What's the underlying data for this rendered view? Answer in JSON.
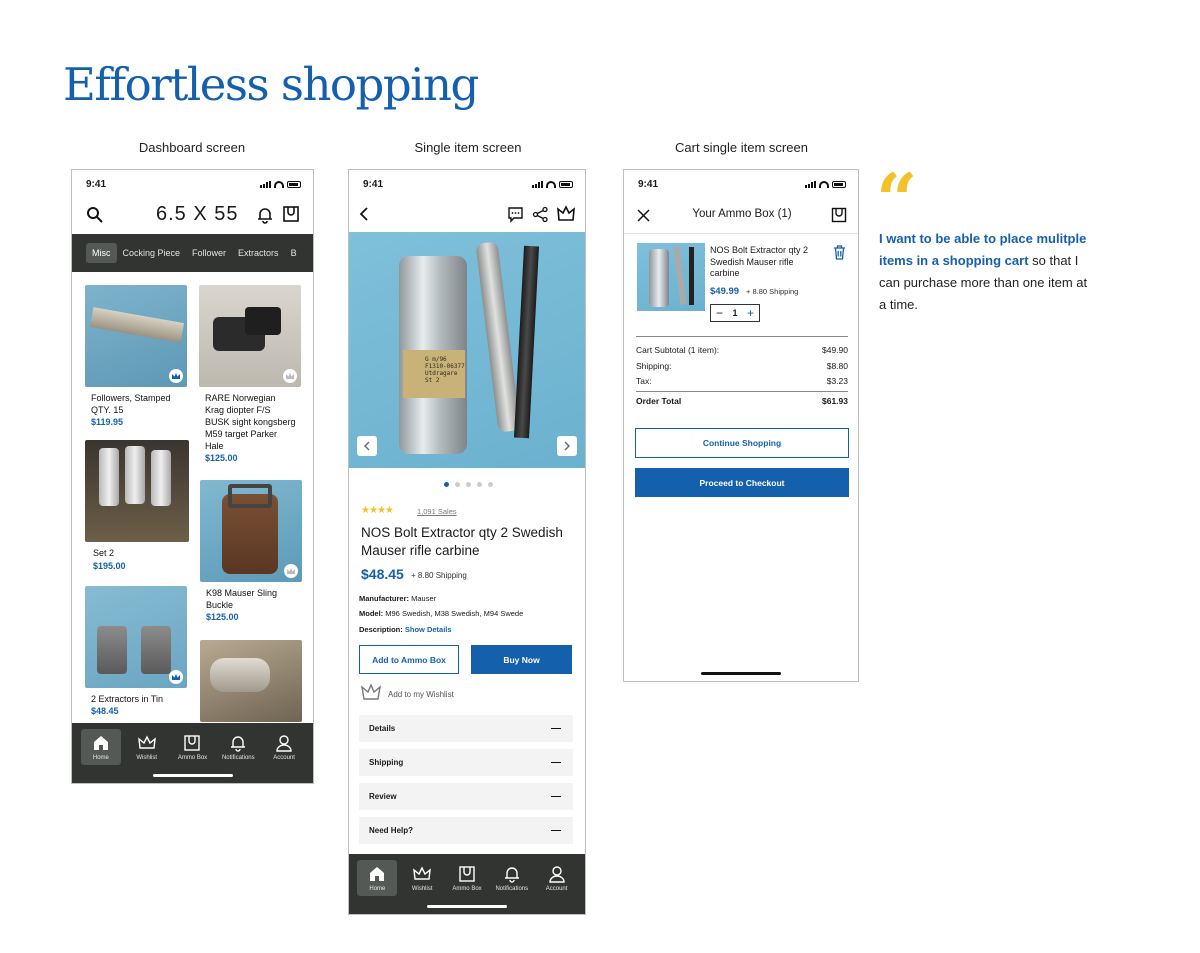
{
  "heading": "Effortless shopping",
  "captions": {
    "dashboard": "Dashboard screen",
    "single": "Single item screen",
    "cart": "Cart single item screen"
  },
  "status_time": "9:41",
  "colors": {
    "brand_blue": "#1560ad",
    "nav_dark": "#313431",
    "quote_gold": "#f3c12a"
  },
  "nav": [
    {
      "label": "Home",
      "icon": "home-icon"
    },
    {
      "label": "Wishlist",
      "icon": "crown-icon"
    },
    {
      "label": "Ammo Box",
      "icon": "box-icon"
    },
    {
      "label": "Notifications",
      "icon": "bell-icon"
    },
    {
      "label": "Account",
      "icon": "user-icon"
    }
  ],
  "dashboard": {
    "logo": "6.5 X 55",
    "categories": [
      "Misc",
      "Cocking Piece",
      "Follower",
      "Extractors",
      "B"
    ],
    "products": [
      {
        "name": "Followers, Stamped QTY. 15",
        "price": "$119.95"
      },
      {
        "name": "RARE Norwegian Krag diopter F/S BUSK sight kongsberg M59 target Parker Hale",
        "price": "$125.00"
      },
      {
        "name": "Set 2",
        "price": "$195.00"
      },
      {
        "name": "K98 Mauser Sling Buckle",
        "price": "$125.00"
      },
      {
        "name": "2 Extractors in Tin",
        "price": "$48.45"
      }
    ]
  },
  "single": {
    "sales": "1,091 Sales",
    "rating_stars": 4,
    "title": "NOS Bolt Extractor qty 2 Swedish Mauser rifle carbine",
    "price": "$48.45",
    "shipping": "+ 8.80 Shipping",
    "label_text": "G m/96\nF1310-06377\nUtdragare\nSt 2",
    "manufacturer_label": "Manufacturer:",
    "manufacturer": "Mauser",
    "model_label": "Model:",
    "model": "M96 Swedish, M38 Swedish, M94 Swede",
    "description_label": "Description:",
    "description_link": "Show Details",
    "add_button": "Add to Ammo Box",
    "buy_button": "Buy Now",
    "wishlist": "Add to my Wishlist",
    "accordions": [
      "Details",
      "Shipping",
      "Review",
      "Need Help?"
    ],
    "carousel_pages": 5,
    "carousel_active": 1
  },
  "cart": {
    "title": "Your Ammo Box (1)",
    "item_name": "NOS Bolt Extractor qty 2 Swedish Mauser rifle carbine",
    "item_price": "$49.99",
    "item_shipping": "+ 8.80 Shipping",
    "qty": "1",
    "qty_minus": "−",
    "qty_plus": "+",
    "subtotal_label": "Cart Subtotal (1 item):",
    "subtotal": "$49.90",
    "shipping_label": "Shipping:",
    "shipping": "$8.80",
    "tax_label": "Tax:",
    "tax": "$3.23",
    "total_label": "Order Total",
    "total": "$61.93",
    "continue_button": "Continue Shopping",
    "checkout_button": "Proceed to Checkout"
  },
  "quote": {
    "mark": "“",
    "bold": "I want to be able to place mulitple items in a shopping cart",
    "rest": " so that I can purchase more than one item at a time."
  }
}
